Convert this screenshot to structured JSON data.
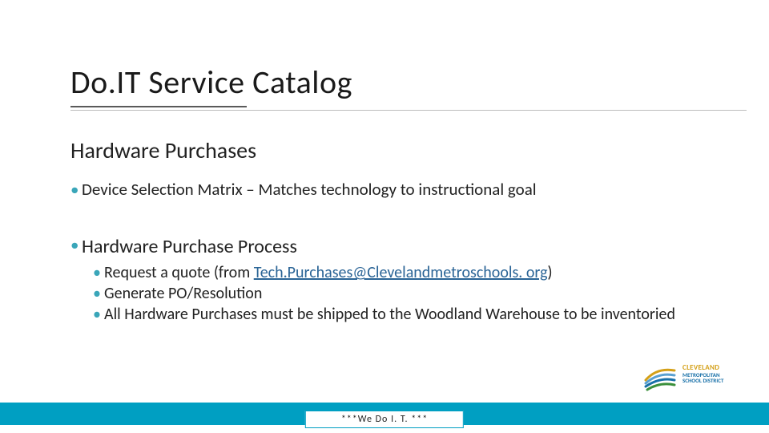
{
  "title": "Do.IT Service Catalog",
  "subtitle": "Hardware Purchases",
  "bullets": {
    "b1": "Device Selection Matrix – Matches technology to instructional goal",
    "b2": "Hardware Purchase Process",
    "sub": {
      "s1_prefix": "Request a quote (from ",
      "s1_link": "Tech.Purchases@Clevelandmetroschools. org",
      "s1_suffix": ")",
      "s2": "Generate PO/Resolution",
      "s3": "All Hardware Purchases must be shipped to the Woodland Warehouse to be inventoried"
    }
  },
  "logo": {
    "line1": "CLEVELAND",
    "line2": "METROPOLITAN",
    "line3": "SCHOOL DISTRICT"
  },
  "tagline": "***We Do I. T. ***",
  "colors": {
    "accent": "#009fc2",
    "bullet": "#3aa6b9",
    "logoGold": "#d4a017",
    "logoBlue": "#1870a8"
  }
}
